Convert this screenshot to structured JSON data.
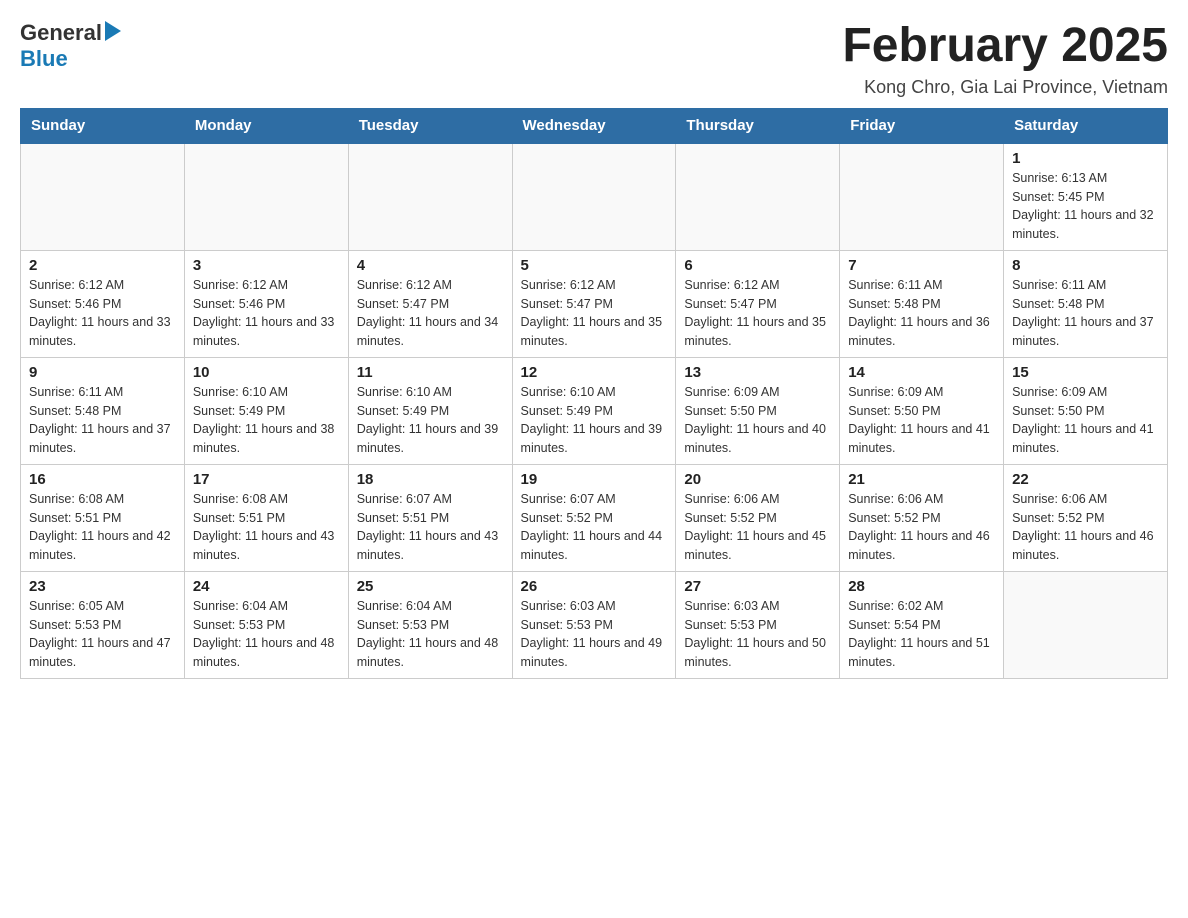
{
  "header": {
    "logo_general": "General",
    "logo_blue": "Blue",
    "month_title": "February 2025",
    "location": "Kong Chro, Gia Lai Province, Vietnam"
  },
  "days_of_week": [
    "Sunday",
    "Monday",
    "Tuesday",
    "Wednesday",
    "Thursday",
    "Friday",
    "Saturday"
  ],
  "weeks": [
    {
      "days": [
        {
          "number": "",
          "info": ""
        },
        {
          "number": "",
          "info": ""
        },
        {
          "number": "",
          "info": ""
        },
        {
          "number": "",
          "info": ""
        },
        {
          "number": "",
          "info": ""
        },
        {
          "number": "",
          "info": ""
        },
        {
          "number": "1",
          "info": "Sunrise: 6:13 AM\nSunset: 5:45 PM\nDaylight: 11 hours and 32 minutes."
        }
      ]
    },
    {
      "days": [
        {
          "number": "2",
          "info": "Sunrise: 6:12 AM\nSunset: 5:46 PM\nDaylight: 11 hours and 33 minutes."
        },
        {
          "number": "3",
          "info": "Sunrise: 6:12 AM\nSunset: 5:46 PM\nDaylight: 11 hours and 33 minutes."
        },
        {
          "number": "4",
          "info": "Sunrise: 6:12 AM\nSunset: 5:47 PM\nDaylight: 11 hours and 34 minutes."
        },
        {
          "number": "5",
          "info": "Sunrise: 6:12 AM\nSunset: 5:47 PM\nDaylight: 11 hours and 35 minutes."
        },
        {
          "number": "6",
          "info": "Sunrise: 6:12 AM\nSunset: 5:47 PM\nDaylight: 11 hours and 35 minutes."
        },
        {
          "number": "7",
          "info": "Sunrise: 6:11 AM\nSunset: 5:48 PM\nDaylight: 11 hours and 36 minutes."
        },
        {
          "number": "8",
          "info": "Sunrise: 6:11 AM\nSunset: 5:48 PM\nDaylight: 11 hours and 37 minutes."
        }
      ]
    },
    {
      "days": [
        {
          "number": "9",
          "info": "Sunrise: 6:11 AM\nSunset: 5:48 PM\nDaylight: 11 hours and 37 minutes."
        },
        {
          "number": "10",
          "info": "Sunrise: 6:10 AM\nSunset: 5:49 PM\nDaylight: 11 hours and 38 minutes."
        },
        {
          "number": "11",
          "info": "Sunrise: 6:10 AM\nSunset: 5:49 PM\nDaylight: 11 hours and 39 minutes."
        },
        {
          "number": "12",
          "info": "Sunrise: 6:10 AM\nSunset: 5:49 PM\nDaylight: 11 hours and 39 minutes."
        },
        {
          "number": "13",
          "info": "Sunrise: 6:09 AM\nSunset: 5:50 PM\nDaylight: 11 hours and 40 minutes."
        },
        {
          "number": "14",
          "info": "Sunrise: 6:09 AM\nSunset: 5:50 PM\nDaylight: 11 hours and 41 minutes."
        },
        {
          "number": "15",
          "info": "Sunrise: 6:09 AM\nSunset: 5:50 PM\nDaylight: 11 hours and 41 minutes."
        }
      ]
    },
    {
      "days": [
        {
          "number": "16",
          "info": "Sunrise: 6:08 AM\nSunset: 5:51 PM\nDaylight: 11 hours and 42 minutes."
        },
        {
          "number": "17",
          "info": "Sunrise: 6:08 AM\nSunset: 5:51 PM\nDaylight: 11 hours and 43 minutes."
        },
        {
          "number": "18",
          "info": "Sunrise: 6:07 AM\nSunset: 5:51 PM\nDaylight: 11 hours and 43 minutes."
        },
        {
          "number": "19",
          "info": "Sunrise: 6:07 AM\nSunset: 5:52 PM\nDaylight: 11 hours and 44 minutes."
        },
        {
          "number": "20",
          "info": "Sunrise: 6:06 AM\nSunset: 5:52 PM\nDaylight: 11 hours and 45 minutes."
        },
        {
          "number": "21",
          "info": "Sunrise: 6:06 AM\nSunset: 5:52 PM\nDaylight: 11 hours and 46 minutes."
        },
        {
          "number": "22",
          "info": "Sunrise: 6:06 AM\nSunset: 5:52 PM\nDaylight: 11 hours and 46 minutes."
        }
      ]
    },
    {
      "days": [
        {
          "number": "23",
          "info": "Sunrise: 6:05 AM\nSunset: 5:53 PM\nDaylight: 11 hours and 47 minutes."
        },
        {
          "number": "24",
          "info": "Sunrise: 6:04 AM\nSunset: 5:53 PM\nDaylight: 11 hours and 48 minutes."
        },
        {
          "number": "25",
          "info": "Sunrise: 6:04 AM\nSunset: 5:53 PM\nDaylight: 11 hours and 48 minutes."
        },
        {
          "number": "26",
          "info": "Sunrise: 6:03 AM\nSunset: 5:53 PM\nDaylight: 11 hours and 49 minutes."
        },
        {
          "number": "27",
          "info": "Sunrise: 6:03 AM\nSunset: 5:53 PM\nDaylight: 11 hours and 50 minutes."
        },
        {
          "number": "28",
          "info": "Sunrise: 6:02 AM\nSunset: 5:54 PM\nDaylight: 11 hours and 51 minutes."
        },
        {
          "number": "",
          "info": ""
        }
      ]
    }
  ]
}
